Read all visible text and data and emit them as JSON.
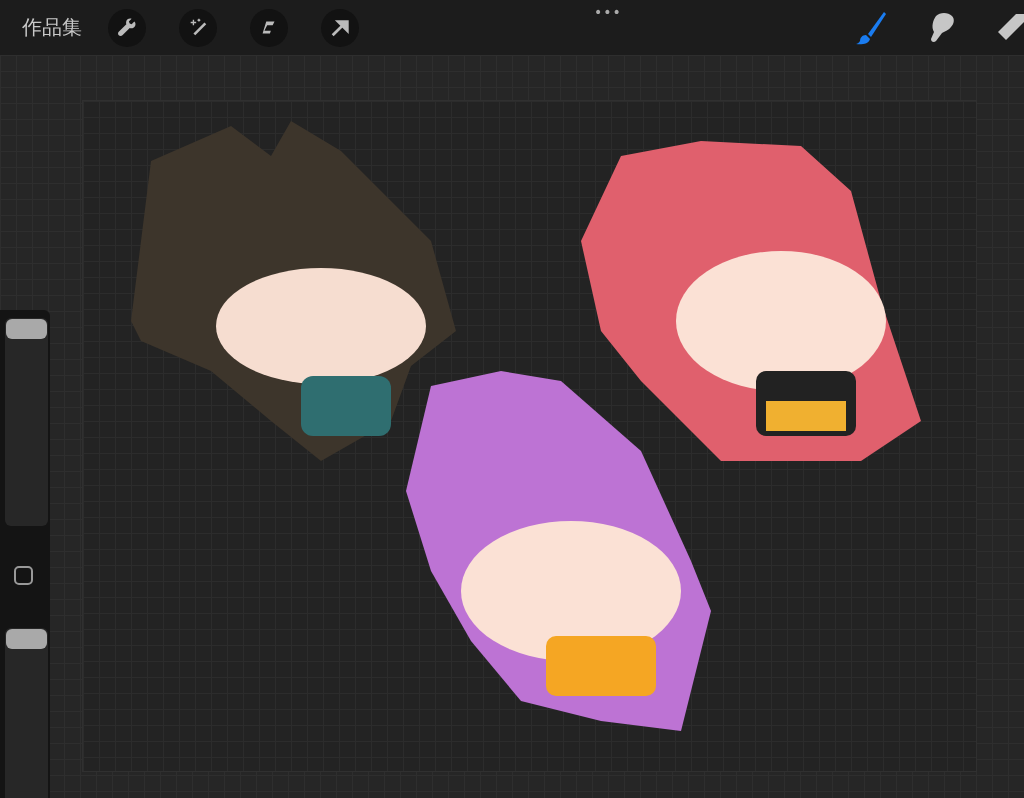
{
  "top_bar": {
    "gallery_label": "作品集",
    "more_label": "•••"
  },
  "tools": [
    {
      "kind": "brush",
      "selected": true
    },
    {
      "kind": "smudge",
      "selected": false
    },
    {
      "kind": "eraser",
      "selected": false
    }
  ],
  "sidebar": {
    "size_slider": {
      "level": 1
    },
    "opacity_slider": {
      "level": 1
    }
  }
}
